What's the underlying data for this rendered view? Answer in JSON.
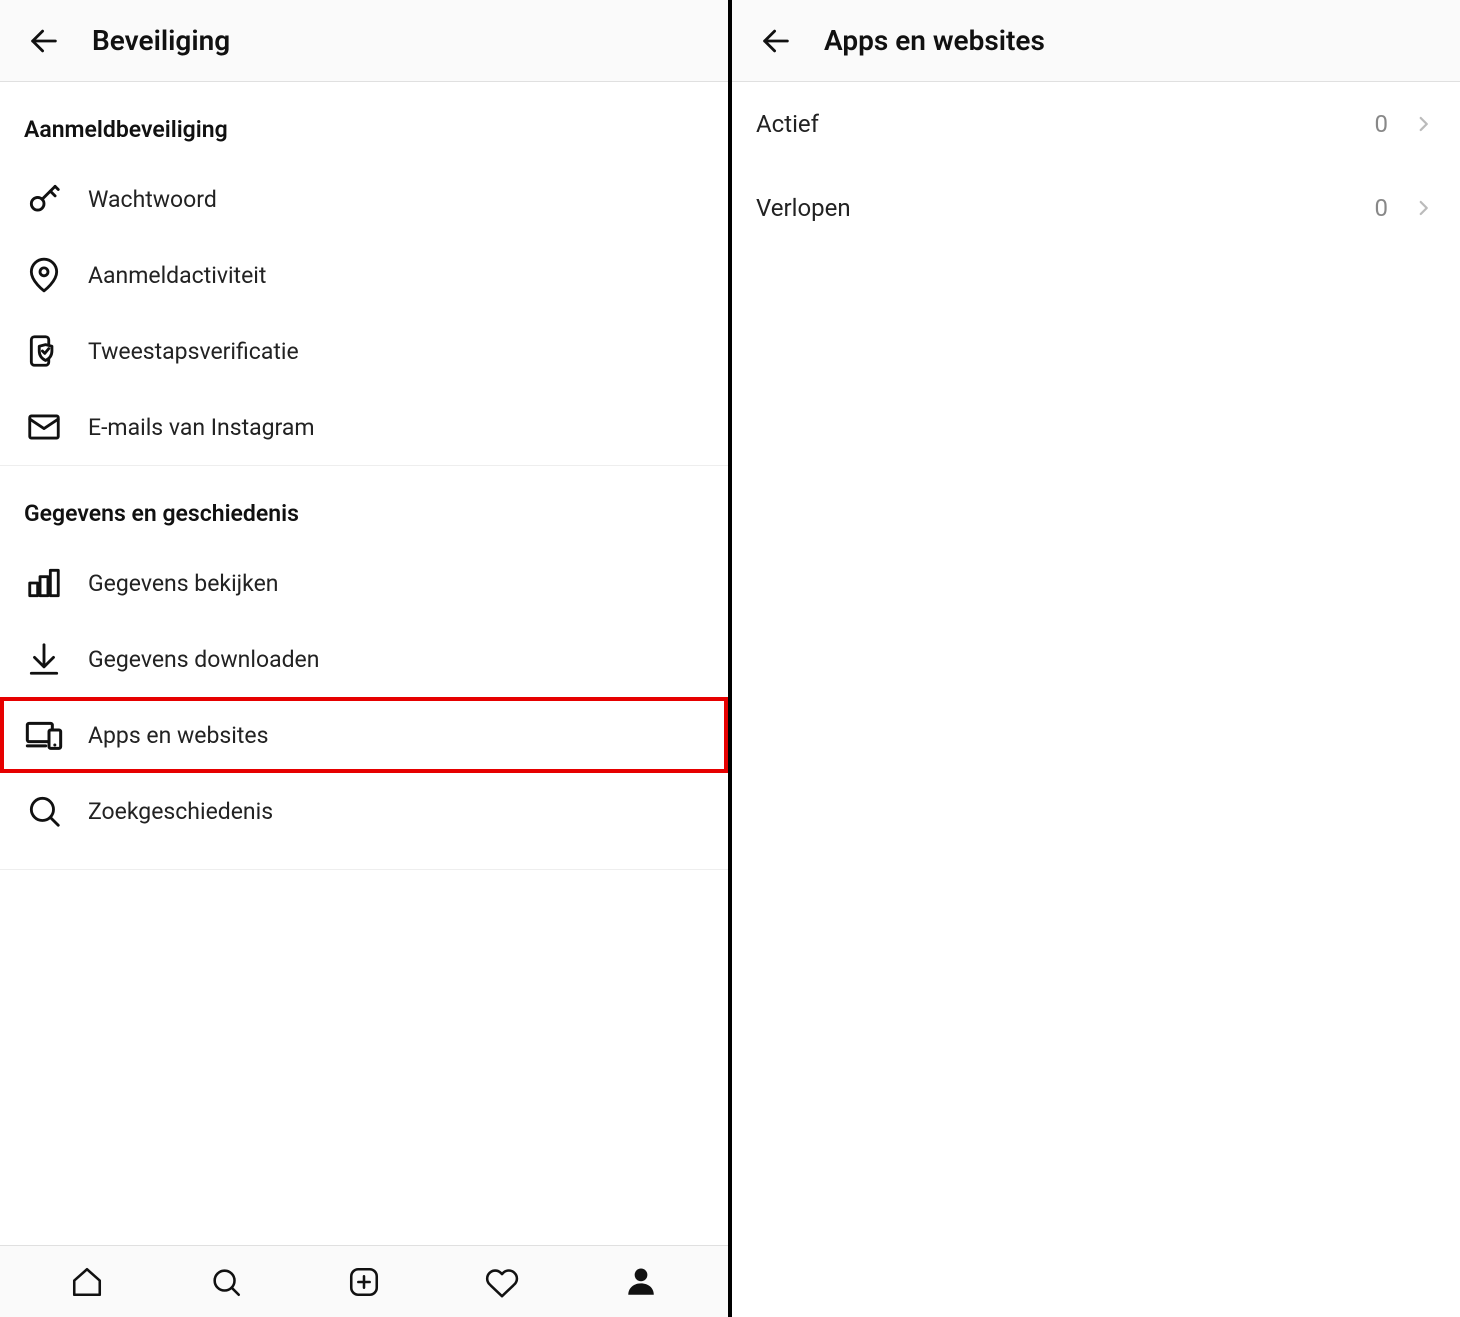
{
  "left": {
    "title": "Beveiliging",
    "sections": [
      {
        "title": "Aanmeldbeveiliging",
        "items": [
          {
            "icon": "key",
            "label": "Wachtwoord"
          },
          {
            "icon": "pin",
            "label": "Aanmeldactiviteit"
          },
          {
            "icon": "shield-phone",
            "label": "Tweestapsverificatie"
          },
          {
            "icon": "mail",
            "label": "E-mails van Instagram"
          }
        ]
      },
      {
        "title": "Gegevens en geschiedenis",
        "items": [
          {
            "icon": "chart",
            "label": "Gegevens bekijken"
          },
          {
            "icon": "download",
            "label": "Gegevens downloaden"
          },
          {
            "icon": "devices",
            "label": "Apps en websites",
            "highlight": true
          },
          {
            "icon": "search",
            "label": "Zoekgeschiedenis"
          }
        ]
      }
    ],
    "tabs": [
      "home",
      "search",
      "add",
      "heart",
      "profile"
    ]
  },
  "right": {
    "title": "Apps en websites",
    "rows": [
      {
        "label": "Actief",
        "count": "0"
      },
      {
        "label": "Verlopen",
        "count": "0"
      }
    ]
  }
}
